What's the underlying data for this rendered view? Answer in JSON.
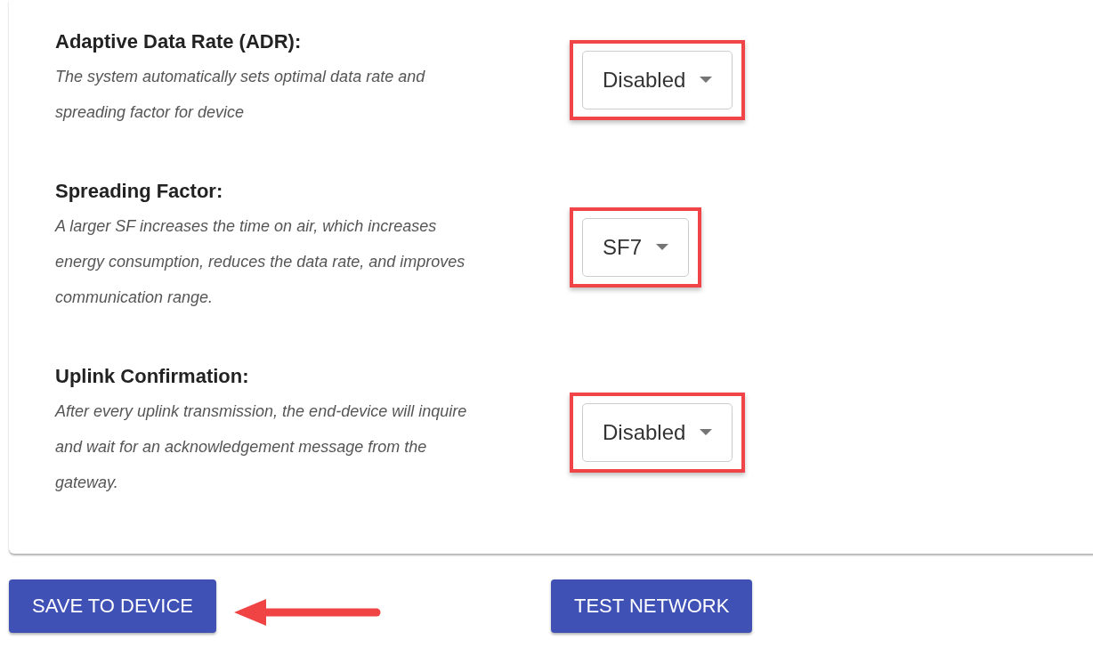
{
  "settings": [
    {
      "title": "Adaptive Data Rate (ADR):",
      "description": "The system automatically sets optimal data rate and spreading factor for device",
      "value": "Disabled",
      "highlighted": true
    },
    {
      "title": "Spreading Factor:",
      "description": "A larger SF increases the time on air, which increases energy consumption, reduces the data rate, and improves communication range.",
      "value": "SF7",
      "highlighted": true
    },
    {
      "title": "Uplink Confirmation:",
      "description": "After every uplink transmission, the end-device will inquire and wait for an acknowledgement message from the gateway.",
      "value": "Disabled",
      "highlighted": true
    }
  ],
  "buttons": [
    {
      "label": "SAVE TO DEVICE"
    },
    {
      "label": "TEST NETWORK"
    }
  ],
  "pointer_arrow": true
}
